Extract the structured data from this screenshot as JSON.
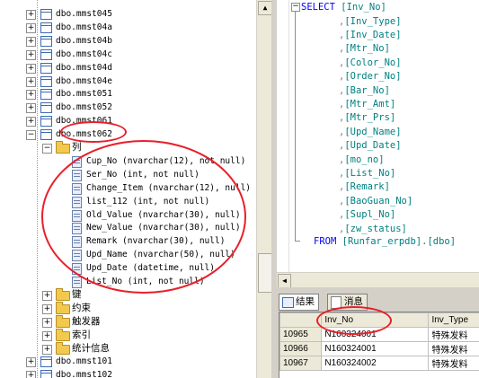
{
  "tree": {
    "tables_top": [
      "dbo.mmst045",
      "dbo.mmst04a",
      "dbo.mmst04b",
      "dbo.mmst04c",
      "dbo.mmst04d",
      "dbo.mmst04e",
      "dbo.mmst051",
      "dbo.mmst052",
      "dbo.mmst061"
    ],
    "expanded_table": "dbo.mmst062",
    "columns_folder": "列",
    "columns": [
      "Cup_No (nvarchar(12), not null)",
      "Ser_No (int, not null)",
      "Change_Item (nvarchar(12), null)",
      "list_112 (int, not null)",
      "Old_Value (nvarchar(30), null)",
      "New_Value (nvarchar(30), null)",
      "Remark (nvarchar(30), null)",
      "Upd_Name (nvarchar(50), null)",
      "Upd_Date (datetime, null)",
      "List_No (int, not null)"
    ],
    "folders": [
      "键",
      "约束",
      "触发器",
      "索引",
      "统计信息"
    ],
    "tables_bottom": [
      "dbo.mmst101",
      "dbo.mmst102"
    ]
  },
  "sql": {
    "select_kw": "SELECT",
    "first_col": "[Inv_No]",
    "cols": [
      "[Inv_Type]",
      "[Inv_Date]",
      "[Mtr_No]",
      "[Color_No]",
      "[Order_No]",
      "[Bar_No]",
      "[Mtr_Amt]",
      "[Mtr_Prs]",
      "[Upd_Name]",
      "[Upd_Date]",
      "[mo_no]",
      "[List_No]",
      "[Remark]",
      "[BaoGuan_No]",
      "[Supl_No]",
      "[zw_status]"
    ],
    "from_kw": "FROM",
    "from_target": "[Runfar_erpdb].[dbo]"
  },
  "results": {
    "tabs": [
      "结果",
      "消息"
    ],
    "headers": [
      "Inv_No",
      "Inv_Type"
    ],
    "rows": [
      {
        "rn": "10965",
        "inv_no": "N160324001",
        "inv_type": "特殊发料"
      },
      {
        "rn": "10966",
        "inv_no": "N160324001",
        "inv_type": "特殊发料"
      },
      {
        "rn": "10967",
        "inv_no": "N160324002",
        "inv_type": "特殊发料"
      }
    ]
  },
  "colors": {
    "annotation": "#e8202a",
    "keyword": "#0000ff",
    "identifier": "#008080"
  }
}
